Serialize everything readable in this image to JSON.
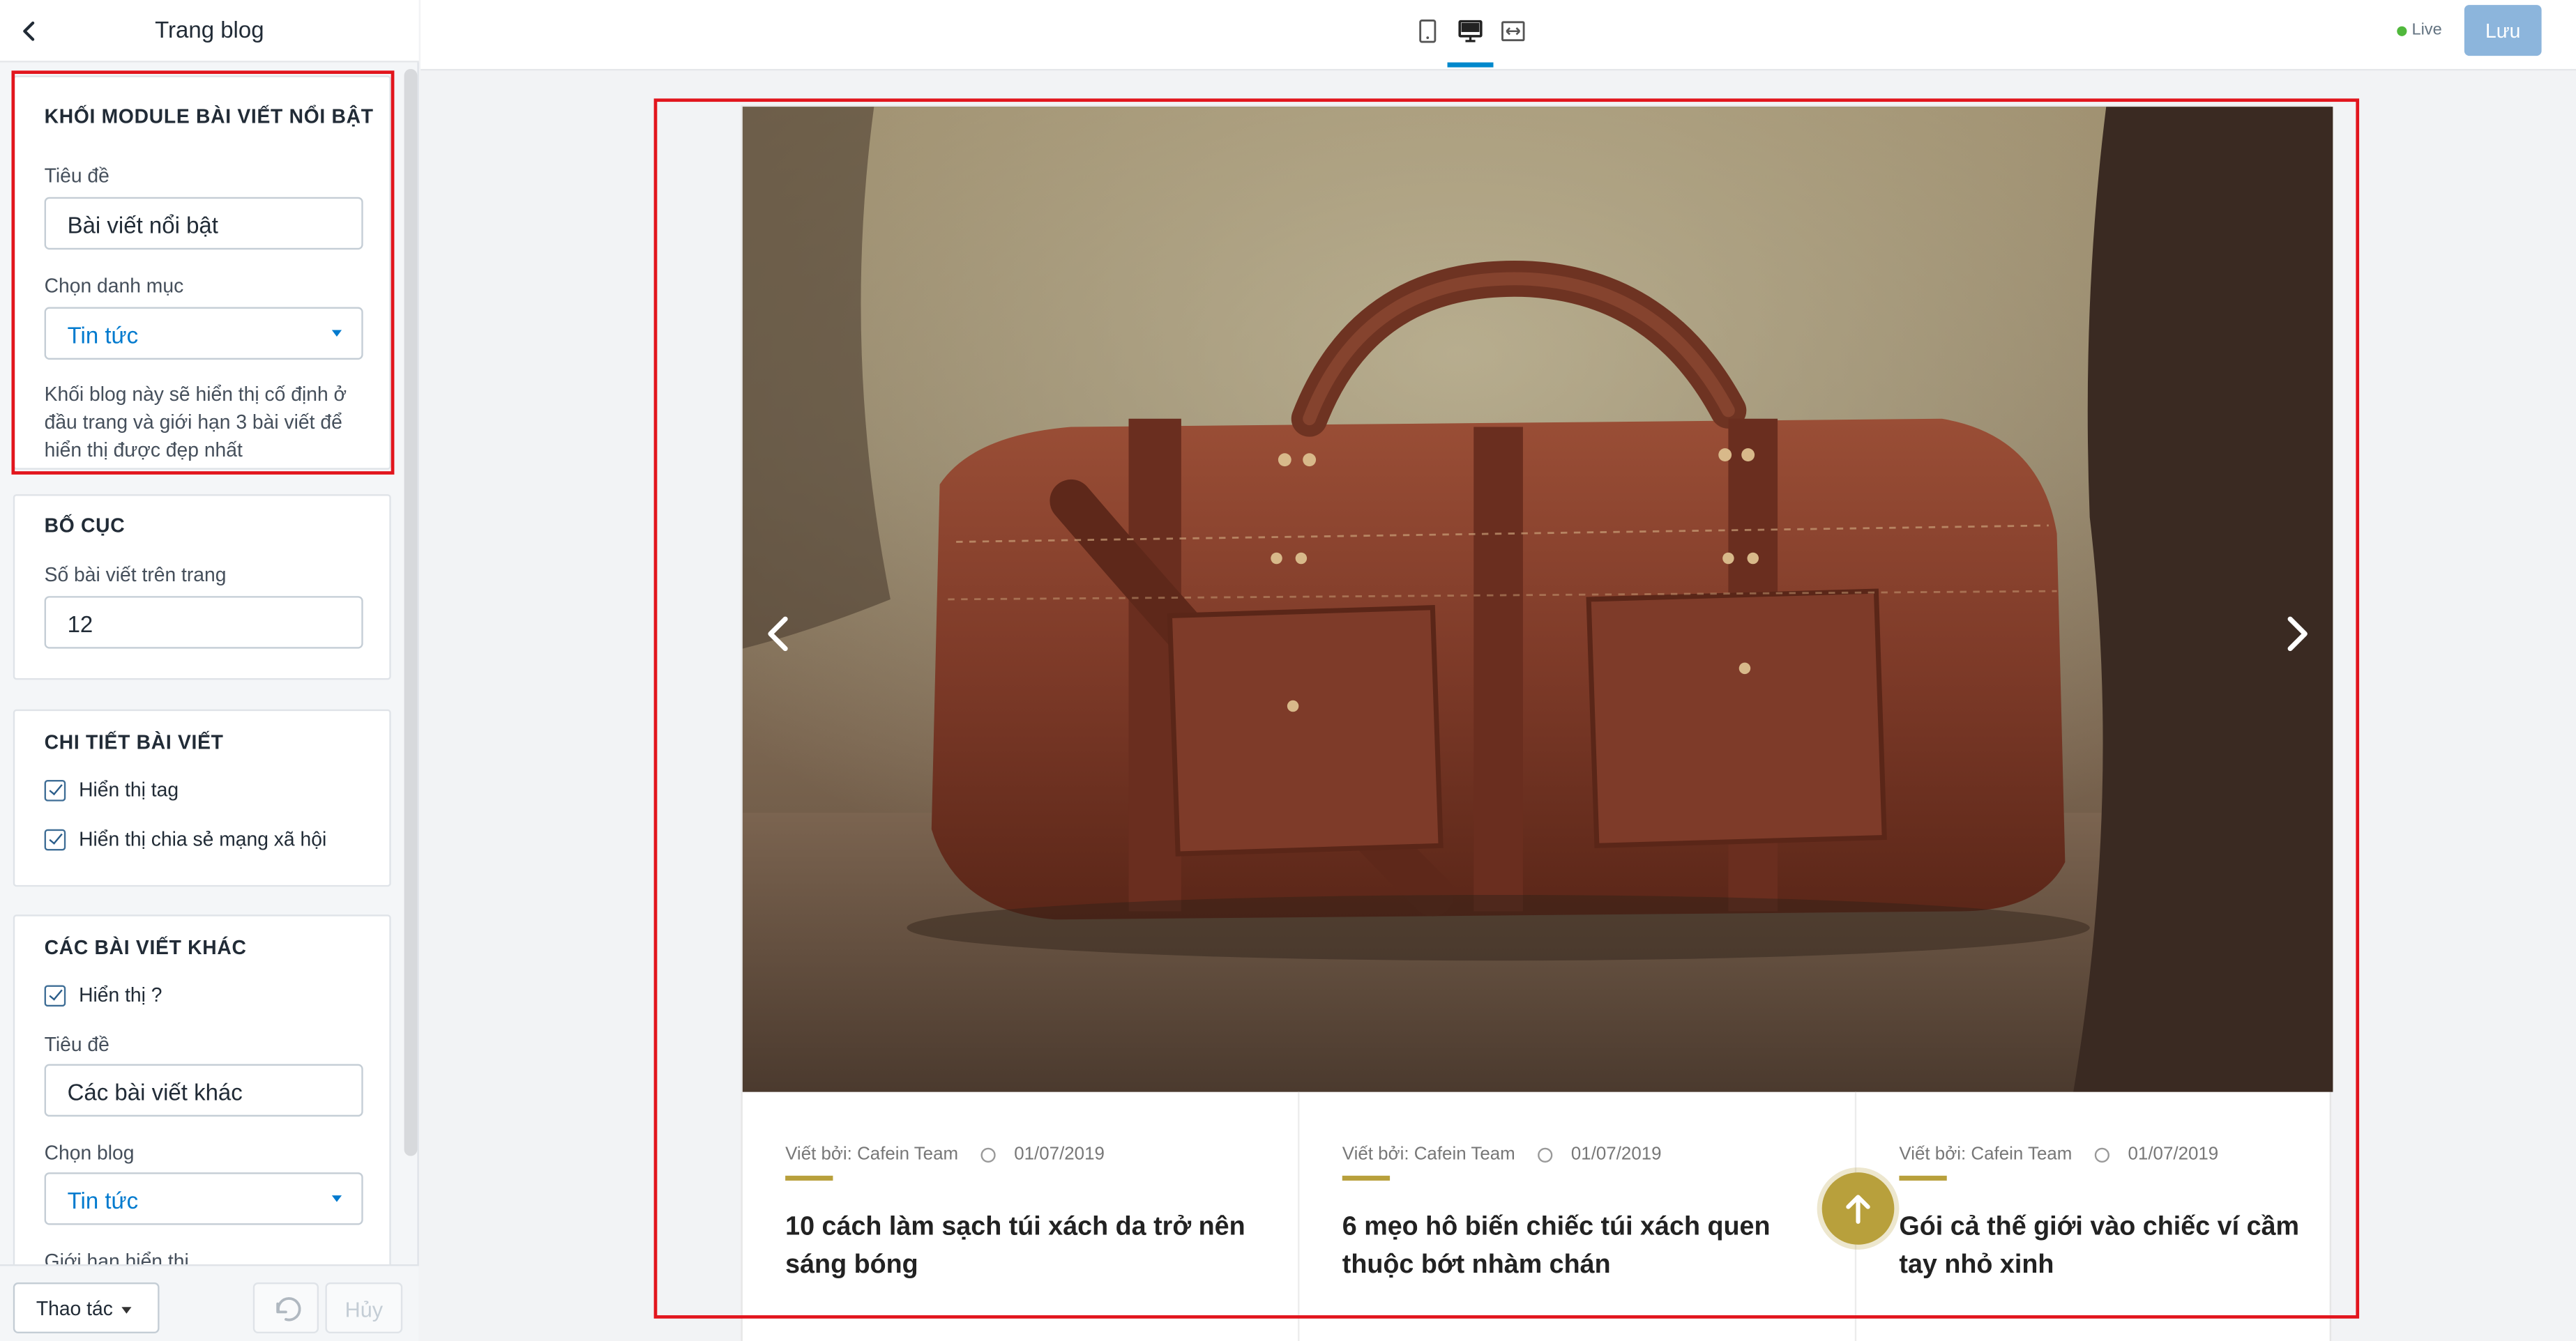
{
  "sidebar": {
    "title": "Trang blog",
    "featured": {
      "heading": "KHỐI MODULE BÀI VIẾT NỔI BẬT",
      "title_label": "Tiêu đề",
      "title_value": "Bài viết nổi bật",
      "category_label": "Chọn danh mục",
      "category_value": "Tin tức",
      "help": "Khối blog này sẽ hiển thị cố định ở đầu trang và giới hạn 3 bài viết để hiển thị được đẹp nhất"
    },
    "layout": {
      "heading": "BỐ CỤC",
      "per_page_label": "Số bài viết trên trang",
      "per_page_value": "12"
    },
    "article_detail": {
      "heading": "CHI TIẾT BÀI VIẾT",
      "show_tag": "Hiển thị tag",
      "show_share": "Hiển thị chia sẻ mạng xã hội"
    },
    "other_posts": {
      "heading": "CÁC BÀI VIẾT KHÁC",
      "show": "Hiển thị ?",
      "title_label": "Tiêu đề",
      "title_value": "Các bài viết khác",
      "blog_label": "Chọn blog",
      "blog_value": "Tin tức",
      "limit_label": "Giới hạn hiển thị"
    },
    "footer": {
      "action_label": "Thao tác",
      "cancel_label": "Hủy"
    }
  },
  "topbar": {
    "live_label": "Live",
    "save_label": "Lưu"
  },
  "preview": {
    "posts": [
      {
        "author": "Viết bởi: Cafein Team",
        "date": "01/07/2019",
        "title": "10 cách làm sạch túi xách da trở nên sáng bóng"
      },
      {
        "author": "Viết bởi: Cafein Team",
        "date": "01/07/2019",
        "title": "6 mẹo hô biến chiếc túi xách quen thuộc bớt nhàm chán"
      },
      {
        "author": "Viết bởi: Cafein Team",
        "date": "01/07/2019",
        "title": "Gói cả thế giới vào chiếc ví cầm tay nhỏ xinh"
      }
    ]
  },
  "colors": {
    "accent_gold": "#b8a03c",
    "highlight_red": "#e2151d",
    "link_blue": "#007ace",
    "save_button": "#8cb5dc"
  },
  "icons": [
    "back-chevron-icon",
    "mobile-device-icon",
    "desktop-device-icon",
    "fullwidth-device-icon",
    "undo-icon",
    "slider-prev-icon",
    "slider-next-icon",
    "arrow-up-icon"
  ]
}
